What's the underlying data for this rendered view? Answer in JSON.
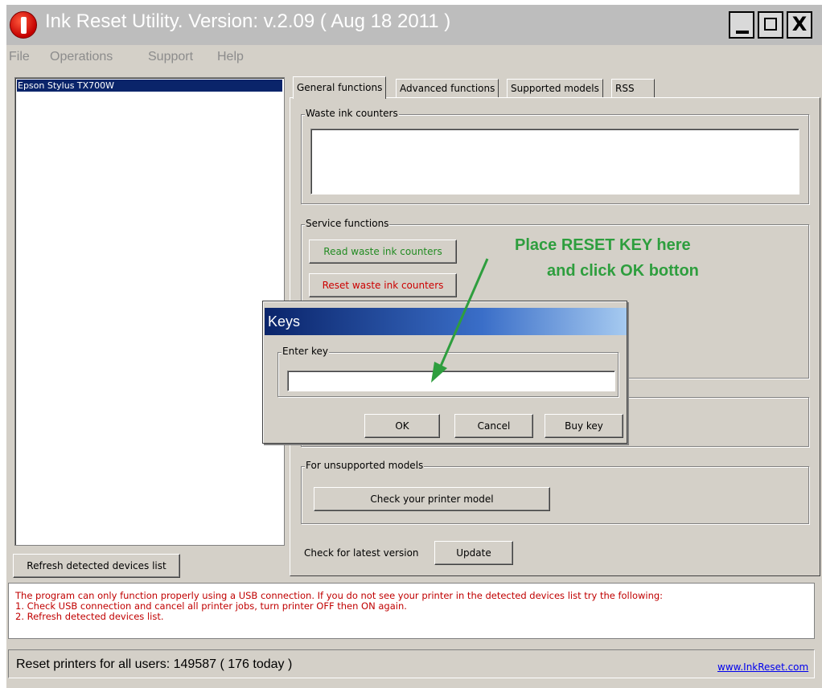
{
  "window": {
    "title": "Ink Reset Utility. Version: v.2.09 ( Aug 18 2011 )",
    "minimize_label": "_",
    "close_label": "X"
  },
  "menu": [
    "File",
    "Operations",
    "Support",
    "Help"
  ],
  "devices": {
    "items": [
      "Epson Stylus TX700W"
    ],
    "refresh_label": "Refresh detected devices list"
  },
  "tabs": [
    "General functions",
    "Advanced functions",
    "Supported models",
    "RSS"
  ],
  "waste_counters": {
    "label": "Waste ink counters"
  },
  "service": {
    "label": "Service functions",
    "read_label": "Read waste ink counters",
    "reset_label": "Reset waste ink counters",
    "read_color": "#228b22",
    "reset_color": "#cc0000"
  },
  "unsupported": {
    "label": "For unsupported models",
    "check_label": "Check your printer model"
  },
  "update": {
    "label": "Check for latest version",
    "button": "Update"
  },
  "annotation": {
    "line1": "Place RESET KEY here",
    "line2": "and click OK botton",
    "color": "#2e9e3e"
  },
  "dialog": {
    "title": "Keys",
    "group_label": "Enter key",
    "key_value": "",
    "ok": "OK",
    "cancel": "Cancel",
    "buy": "Buy key"
  },
  "info": {
    "line1": "The program can only function properly using a USB connection. If you do not see your printer in the detected devices list try the following:",
    "line2": "1. Check USB connection and cancel all printer jobs, turn printer OFF then ON again.",
    "line3": "2. Refresh detected devices list."
  },
  "status": {
    "text": "Reset printers for all users: 149587 ( 176 today )",
    "link": "www.InkReset.com"
  }
}
